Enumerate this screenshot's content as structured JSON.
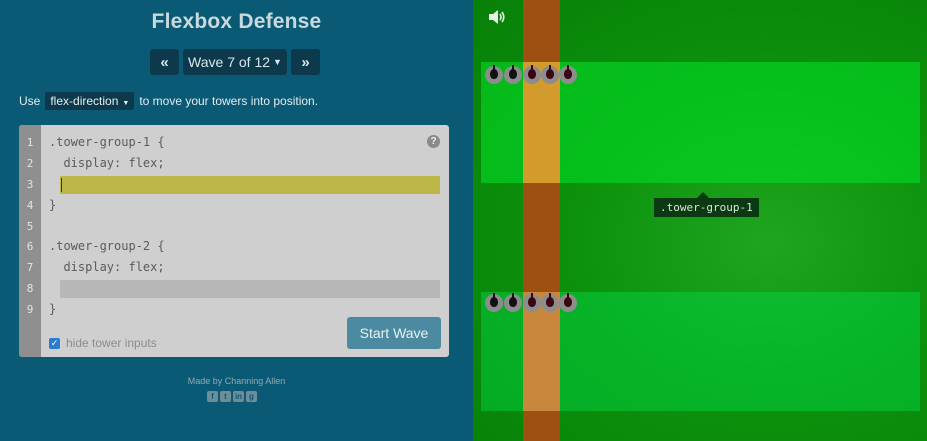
{
  "app": {
    "title": "Flexbox Defense"
  },
  "wave_nav": {
    "prev": "«",
    "current": "Wave 7 of 12",
    "next": "»"
  },
  "instructions": {
    "prefix": "Use",
    "property": "flex-direction",
    "suffix": "to move your towers into position."
  },
  "editor": {
    "line_numbers": [
      "1",
      "2",
      "3",
      "4",
      "5",
      "6",
      "7",
      "8",
      "9"
    ],
    "lines": [
      {
        "line": "1",
        "text": ".tower-group-1 {"
      },
      {
        "line": "2",
        "text": "  display: flex;"
      },
      {
        "line": "3",
        "text": ""
      },
      {
        "line": "4",
        "text": "}"
      },
      {
        "line": "5",
        "text": ""
      },
      {
        "line": "6",
        "text": ".tower-group-2 {"
      },
      {
        "line": "7",
        "text": "  display: flex;"
      },
      {
        "line": "8",
        "text": ""
      },
      {
        "line": "9",
        "text": "}"
      }
    ],
    "help": "?",
    "hide_inputs_label": "hide tower inputs",
    "hide_inputs_checked": true,
    "start_button": "Start Wave"
  },
  "footer": {
    "credit": "Made by Channing Allen",
    "social_icons": [
      "facebook-icon",
      "twitter-icon",
      "linkedin-icon",
      "github-icon"
    ]
  },
  "field": {
    "tooltip": ".tower-group-1",
    "group1_towers": [
      "black",
      "black",
      "dark-red",
      "dark-red",
      "dark-red"
    ],
    "group2_towers": [
      "black",
      "black",
      "dark-red",
      "dark-red",
      "dark-red"
    ]
  },
  "colors": {
    "panel": "#0a5a75",
    "field": "#119a11",
    "path": "#9e4f12",
    "start_button": "#4b8aa0"
  }
}
